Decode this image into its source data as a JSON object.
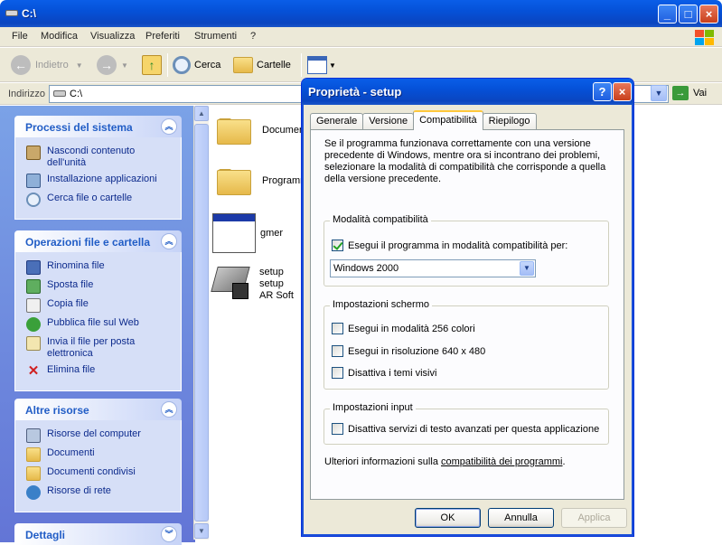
{
  "explorer": {
    "title": "C:\\",
    "menu": [
      "File",
      "Modifica",
      "Visualizza",
      "Preferiti",
      "Strumenti",
      "?"
    ],
    "toolbar": {
      "back_label": "Indietro",
      "search_label": "Cerca",
      "folders_label": "Cartelle"
    },
    "address": {
      "label": "Indirizzo",
      "value": "C:\\",
      "go_label": "Vai"
    },
    "panels": [
      {
        "title": "Processi del sistema",
        "items": [
          {
            "label": "Nascondi contenuto dell'unità",
            "icon": "hide-contents-icon"
          },
          {
            "label": "Installazione applicazioni",
            "icon": "add-remove-programs-icon"
          },
          {
            "label": "Cerca file o cartelle",
            "icon": "search-icon"
          }
        ]
      },
      {
        "title": "Operazioni file e cartella",
        "items": [
          {
            "label": "Rinomina file",
            "icon": "rename-icon"
          },
          {
            "label": "Sposta file",
            "icon": "move-icon"
          },
          {
            "label": "Copia file",
            "icon": "copy-icon"
          },
          {
            "label": "Pubblica file sul Web",
            "icon": "publish-web-icon"
          },
          {
            "label": "Invia il file per posta elettronica",
            "icon": "email-icon"
          },
          {
            "label": "Elimina file",
            "icon": "delete-icon"
          }
        ]
      },
      {
        "title": "Altre risorse",
        "items": [
          {
            "label": "Risorse del computer",
            "icon": "my-computer-icon"
          },
          {
            "label": "Documenti",
            "icon": "folder-icon"
          },
          {
            "label": "Documenti condivisi",
            "icon": "folder-icon"
          },
          {
            "label": "Risorse di rete",
            "icon": "network-icon"
          }
        ]
      },
      {
        "title": "Dettagli",
        "items": []
      }
    ],
    "files": [
      {
        "name": "Documen",
        "icon": "folder-icon"
      },
      {
        "name": "Programm",
        "icon": "folder-icon"
      },
      {
        "name": "gmer",
        "icon": "application-icon"
      },
      {
        "name_lines": [
          "setup",
          "setup",
          "AR Soft"
        ],
        "icon": "setup-icon"
      }
    ]
  },
  "dialog": {
    "title": "Proprietà - setup",
    "tabs": [
      "Generale",
      "Versione",
      "Compatibilità",
      "Riepilogo"
    ],
    "active_tab": "Compatibilità",
    "intro": "Se il programma funzionava correttamente con una versione precedente di Windows, mentre ora si incontrano dei problemi, selezionare la modalità di compatibilità che corrisponde a quella della versione precedente.",
    "compat_group": {
      "title": "Modalità compatibilità",
      "checkbox_label": "Esegui il programma in modalità compatibilità per:",
      "checked": true,
      "selected_os": "Windows 2000"
    },
    "display_group": {
      "title": "Impostazioni schermo",
      "options": [
        {
          "label": "Esegui in modalità 256 colori",
          "checked": false
        },
        {
          "label": "Esegui in risoluzione 640 x 480",
          "checked": false
        },
        {
          "label": "Disattiva i temi visivi",
          "checked": false
        }
      ]
    },
    "input_group": {
      "title": "Impostazioni input",
      "option": {
        "label": "Disattiva servizi di testo avanzati per questa applicazione",
        "checked": false
      }
    },
    "more_info_prefix": "Ulteriori informazioni sulla",
    "more_info_link": "compatibilità dei programmi",
    "more_info_suffix": ".",
    "buttons": {
      "ok": "OK",
      "cancel": "Annulla",
      "apply": "Applica"
    }
  }
}
